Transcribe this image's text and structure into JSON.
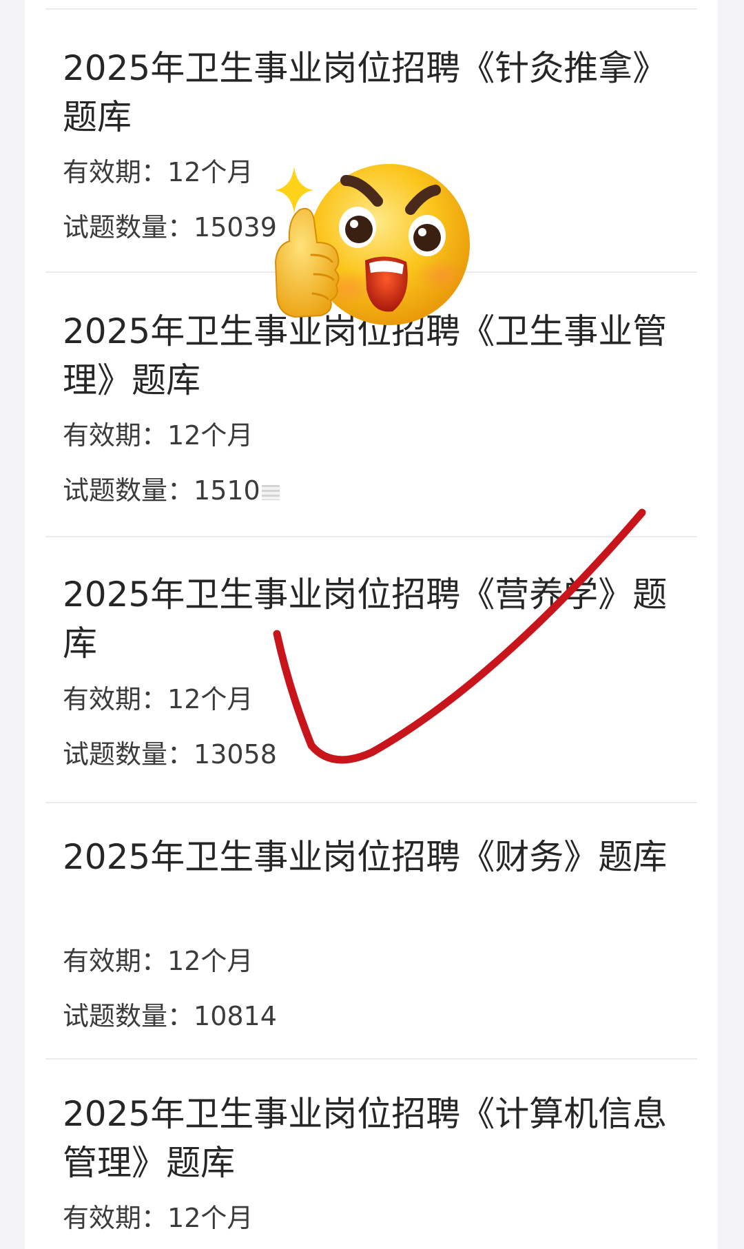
{
  "items": [
    {
      "title": "2025年卫生事业岗位招聘《针灸推拿》题库",
      "validity_label": "有效期：",
      "validity_value": "12个月",
      "count_label": "试题数量：",
      "count_value": "15039"
    },
    {
      "title": "2025年卫生事业岗位招聘《卫生事业管理》题库",
      "validity_label": "有效期：",
      "validity_value": "12个月",
      "count_label": "试题数量：",
      "count_value": "1510"
    },
    {
      "title": "2025年卫生事业岗位招聘《营养学》题库",
      "validity_label": "有效期：",
      "validity_value": "12个月",
      "count_label": "试题数量：",
      "count_value": "13058"
    },
    {
      "title": "2025年卫生事业岗位招聘《财务》题库",
      "validity_label": "有效期：",
      "validity_value": "12个月",
      "count_label": "试题数量：",
      "count_value": "10814"
    },
    {
      "title": "2025年卫生事业岗位招聘《计算机信息管理》题库",
      "validity_label": "有效期：",
      "validity_value": "12个月"
    }
  ],
  "overlays": {
    "emoji": "shocked-thumbs-up-emoji",
    "checkmark_color": "#c8151b",
    "emoji_color": "#f7c21c"
  }
}
